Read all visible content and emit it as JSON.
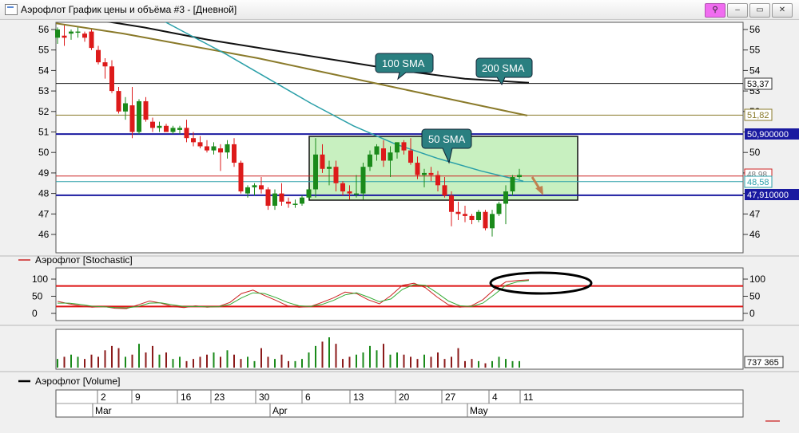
{
  "window": {
    "title": "Аэрофлот График цены и объёма #3 - [Дневной]",
    "buttons": {
      "pin": "⚲",
      "minimize": "–",
      "restore": "▭",
      "close": "✕"
    }
  },
  "price_panel": {
    "y_ticks": [
      "56",
      "55",
      "54",
      "53",
      "52",
      "51",
      "50",
      "49",
      "48",
      "47",
      "46"
    ],
    "right_labels": {
      "black_level": "53,37",
      "olive_level": "51,82",
      "blue_top": "50,900000",
      "obscured": "48,98",
      "teal_level": "48,58",
      "blue_bottom": "47,910000"
    },
    "callouts": {
      "sma100": "100 SMA",
      "sma200": "200 SMA",
      "sma50": "50 SMA"
    }
  },
  "stochastic_panel": {
    "legend": "Аэрофлот [Stochastic]",
    "y_ticks": [
      "100",
      "50",
      "0"
    ]
  },
  "volume_panel": {
    "legend": "Аэрофлот [Volume]",
    "last_value": "737 365"
  },
  "date_axis": {
    "days": [
      "2",
      "9",
      "16",
      "23",
      "30",
      "6",
      "13",
      "20",
      "27",
      "4",
      "11"
    ],
    "months": [
      "Mar",
      "Apr",
      "May"
    ]
  },
  "colors": {
    "up": "#1a8a1a",
    "down": "#dd1a1a",
    "volume_up": "#1a8a1a",
    "volume_down": "#8b1a1a",
    "sma50": "#2a9fa8",
    "sma100": "#8a7a2a",
    "sma200": "#111111",
    "callout": "#2a7f80",
    "range_box": "#c8f0c0",
    "level_blue": "#1a1aa0",
    "stoch_k": "#cc2222",
    "stoch_d": "#33aa33",
    "stoch_band": "#dd1111"
  },
  "chart_data": [
    {
      "type": "candlestick",
      "title": "",
      "ylim": [
        45.5,
        56.3
      ],
      "levels": {
        "blue_top": 50.9,
        "blue_bottom": 47.91,
        "black": 53.37,
        "olive": 51.82,
        "teal": 48.58,
        "red": 48.85
      },
      "candles": [
        [
          55.6,
          56.1,
          55.3,
          56.0
        ],
        [
          55.7,
          56.2,
          55.2,
          55.6
        ],
        [
          55.8,
          56.0,
          55.5,
          55.9
        ],
        [
          55.9,
          56.1,
          55.6,
          55.9
        ],
        [
          55.8,
          55.9,
          55.4,
          55.6
        ],
        [
          55.9,
          56.0,
          55.0,
          55.1
        ],
        [
          55.0,
          55.2,
          54.3,
          54.4
        ],
        [
          54.4,
          54.6,
          53.6,
          54.2
        ],
        [
          54.2,
          54.5,
          52.9,
          53.0
        ],
        [
          53.0,
          53.2,
          51.9,
          52.0
        ],
        [
          52.0,
          52.7,
          51.6,
          52.4
        ],
        [
          52.3,
          53.2,
          50.7,
          51.0
        ],
        [
          51.0,
          52.6,
          50.9,
          52.5
        ],
        [
          52.5,
          52.7,
          51.5,
          51.6
        ],
        [
          51.5,
          51.7,
          51.0,
          51.2
        ],
        [
          51.2,
          51.5,
          51.0,
          51.3
        ],
        [
          51.3,
          51.4,
          51.0,
          51.0
        ],
        [
          51.0,
          51.3,
          50.9,
          51.2
        ],
        [
          51.1,
          51.3,
          50.9,
          51.2
        ],
        [
          51.2,
          51.6,
          50.5,
          50.7
        ],
        [
          50.7,
          51.0,
          50.3,
          50.5
        ],
        [
          50.5,
          50.8,
          50.2,
          50.3
        ],
        [
          50.3,
          50.6,
          50.0,
          50.1
        ],
        [
          50.1,
          50.5,
          49.9,
          50.3
        ],
        [
          50.2,
          50.4,
          49.1,
          50.0
        ],
        [
          50.0,
          50.6,
          49.7,
          50.4
        ],
        [
          50.4,
          50.7,
          49.3,
          49.5
        ],
        [
          49.5,
          49.6,
          48.0,
          48.1
        ],
        [
          48.0,
          48.4,
          47.8,
          48.3
        ],
        [
          48.3,
          48.5,
          47.9,
          48.4
        ],
        [
          48.4,
          48.8,
          48.0,
          48.2
        ],
        [
          48.2,
          48.3,
          47.2,
          47.4
        ],
        [
          47.4,
          48.2,
          47.2,
          48.0
        ],
        [
          48.0,
          48.5,
          47.4,
          47.6
        ],
        [
          47.6,
          47.8,
          47.3,
          47.5
        ],
        [
          47.5,
          47.7,
          47.3,
          47.5
        ],
        [
          47.5,
          47.9,
          47.4,
          47.8
        ],
        [
          47.8,
          48.3,
          47.7,
          48.2
        ],
        [
          48.2,
          50.7,
          47.8,
          49.9
        ],
        [
          49.9,
          50.4,
          49.0,
          49.2
        ],
        [
          49.2,
          49.6,
          48.4,
          49.3
        ],
        [
          49.3,
          49.6,
          48.1,
          48.5
        ],
        [
          48.5,
          48.6,
          47.9,
          48.1
        ],
        [
          48.1,
          48.4,
          47.7,
          48.0
        ],
        [
          48.0,
          48.9,
          47.8,
          48.0
        ],
        [
          48.0,
          49.5,
          47.7,
          49.3
        ],
        [
          49.3,
          50.1,
          49.1,
          49.9
        ],
        [
          49.9,
          50.4,
          49.6,
          50.3
        ],
        [
          50.2,
          50.6,
          49.3,
          49.6
        ],
        [
          49.6,
          50.3,
          48.8,
          50.0
        ],
        [
          50.0,
          50.5,
          49.7,
          50.5
        ],
        [
          50.5,
          50.6,
          49.9,
          50.1
        ],
        [
          50.1,
          50.7,
          49.4,
          49.5
        ],
        [
          49.5,
          49.8,
          48.7,
          48.9
        ],
        [
          48.9,
          49.2,
          48.3,
          49.0
        ],
        [
          49.0,
          49.3,
          48.6,
          48.9
        ],
        [
          48.9,
          49.1,
          48.1,
          48.4
        ],
        [
          48.4,
          48.8,
          47.8,
          47.9
        ],
        [
          47.9,
          48.1,
          46.4,
          47.1
        ],
        [
          47.1,
          47.6,
          46.7,
          47.0
        ],
        [
          47.0,
          47.4,
          46.6,
          46.9
        ],
        [
          46.9,
          47.0,
          46.5,
          46.7
        ],
        [
          46.7,
          47.2,
          46.6,
          47.1
        ],
        [
          47.1,
          47.2,
          46.2,
          46.3
        ],
        [
          46.3,
          47.2,
          45.9,
          47.0
        ],
        [
          47.0,
          47.6,
          46.9,
          47.5
        ],
        [
          47.5,
          48.4,
          46.5,
          48.1
        ],
        [
          48.1,
          48.9,
          47.9,
          48.8
        ],
        [
          48.8,
          49.2,
          48.7,
          48.9
        ]
      ],
      "sma50": [
        58.8,
        57.9,
        57.0,
        55.9,
        54.8,
        53.6,
        52.4,
        51.3,
        50.4,
        49.7,
        49.1,
        48.6
      ],
      "sma100": [
        56.3,
        55.8,
        55.2,
        54.6,
        53.9,
        53.2,
        52.5,
        51.8
      ],
      "sma200": [
        56.6,
        56.1,
        55.5,
        55.0,
        54.5,
        54.0,
        53.6,
        53.4
      ]
    },
    {
      "type": "line",
      "title": "",
      "ylim": [
        0,
        100
      ],
      "series": [
        {
          "values": [
            35,
            28,
            22,
            18,
            20,
            15,
            14,
            25,
            36,
            30,
            20,
            17,
            22,
            18,
            20,
            32,
            58,
            68,
            52,
            38,
            22,
            18,
            20,
            32,
            45,
            62,
            58,
            40,
            28,
            52,
            82,
            88,
            75,
            48,
            25,
            18,
            22,
            40,
            70,
            92,
            96,
            98
          ]
        },
        {
          "values": [
            30,
            30,
            26,
            21,
            19,
            17,
            16,
            20,
            30,
            31,
            25,
            20,
            20,
            19,
            19,
            26,
            45,
            60,
            58,
            46,
            32,
            22,
            20,
            26,
            38,
            54,
            60,
            48,
            34,
            42,
            70,
            84,
            82,
            60,
            36,
            22,
            20,
            30,
            55,
            82,
            92,
            96
          ]
        }
      ],
      "bands": [
        80,
        20
      ]
    },
    {
      "type": "bar",
      "title": "",
      "values": [
        0.4,
        0.5,
        0.6,
        0.5,
        0.4,
        0.6,
        0.5,
        0.8,
        1.0,
        0.9,
        0.5,
        0.6,
        1.1,
        0.7,
        1.0,
        0.6,
        0.7,
        0.4,
        0.5,
        0.3,
        0.4,
        0.5,
        0.6,
        0.7,
        0.5,
        0.8,
        0.6,
        0.4,
        0.5,
        0.3,
        0.9,
        0.5,
        0.4,
        0.6,
        0.3,
        0.3,
        0.4,
        0.7,
        1.0,
        1.2,
        1.4,
        1.1,
        0.4,
        0.5,
        0.6,
        0.7,
        1.0,
        0.8,
        1.1,
        0.6,
        0.7,
        0.6,
        0.5,
        0.4,
        0.6,
        0.5,
        0.7,
        0.4,
        0.5,
        0.9,
        0.3,
        0.4,
        0.3,
        0.2,
        0.3,
        0.5,
        0.4,
        0.3,
        0.3
      ]
    }
  ]
}
